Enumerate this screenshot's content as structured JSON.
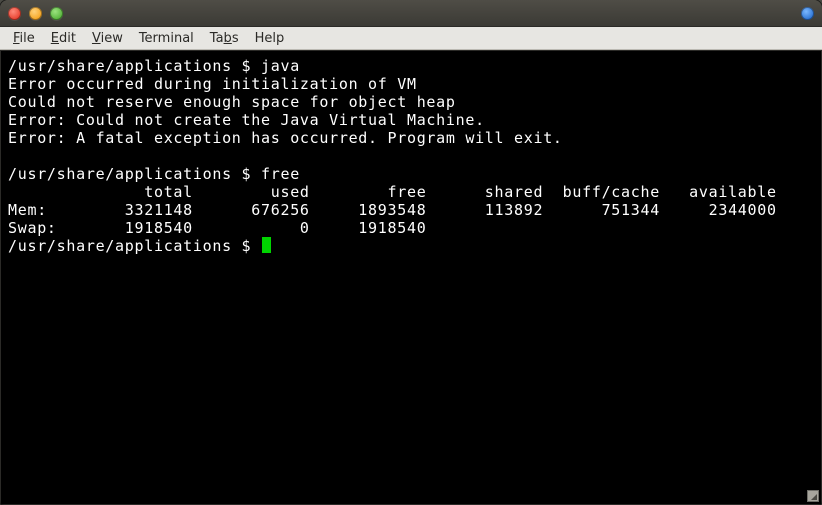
{
  "window": {
    "title": ""
  },
  "menu": {
    "file": "File",
    "edit": "Edit",
    "view": "View",
    "terminal": "Terminal",
    "tabs": "Tabs",
    "help": "Help"
  },
  "term": {
    "prompt": "/usr/share/applications $",
    "cmd1": "java",
    "java_err1": "Error occurred during initialization of VM",
    "java_err2": "Could not reserve enough space for object heap",
    "java_err3": "Error: Could not create the Java Virtual Machine.",
    "java_err4": "Error: A fatal exception has occurred. Program will exit.",
    "cmd2": "free",
    "free_hdr": "              total        used        free      shared  buff/cache   available",
    "free_mem": "Mem:        3321148      676256     1893548      113892      751344     2344000",
    "free_swp": "Swap:       1918540           0     1918540"
  }
}
